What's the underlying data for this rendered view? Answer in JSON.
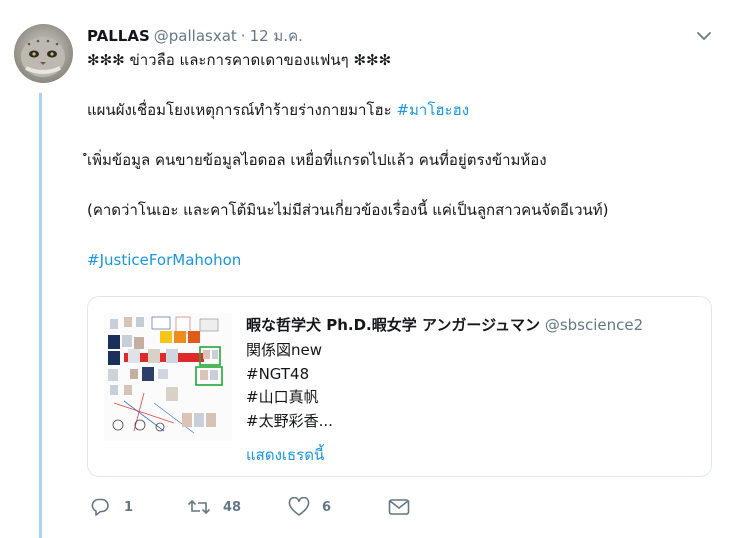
{
  "tweet": {
    "author_name": "PALLAS",
    "author_handle": "@pallasxat",
    "separator": "·",
    "date": "12 ม.ค.",
    "lines": {
      "line1": "✻✻✻ ข่าวลือ และการคาดเดาของแฟนๆ ✻✻✻",
      "line2_text": "แผนผังเชื่อมโยงเหตุการณ์ทำร้ายร่างกายมาโฮะ",
      "line2_tag": "#มาโฮะฮง",
      "line3": "ํเพิ่มข้อมูล คนขายข้อมูลไอดอล เหยื่อที่แกรดไปแล้ว คนที่อยู่ตรงข้ามห้อง",
      "line4": "(คาดว่าโนเอะ และคาโต้มินะไม่มีส่วนเกี่ยวข้องเรื่องนี้ แค่เป็นลูกสาวคนจัดอีเวนท์)",
      "line5_tag": "#JusticeForMahohon"
    }
  },
  "quoted": {
    "author_name": "暇な哲学犬 Ph.D.暇女学 アンガージュマン",
    "author_handle": "@sbscience2",
    "lines": [
      "関係図new",
      "#NGT48",
      "#山口真帆",
      "#太野彩香..."
    ],
    "show_thread": "แสดงเธรดนี้"
  },
  "actions": {
    "reply_count": "1",
    "retweet_count": "48",
    "like_count": "6"
  },
  "colors": {
    "link": "#1b95e0",
    "secondary": "#657786",
    "thread_line": "#a8d4f2",
    "border": "#e1e8ed"
  }
}
